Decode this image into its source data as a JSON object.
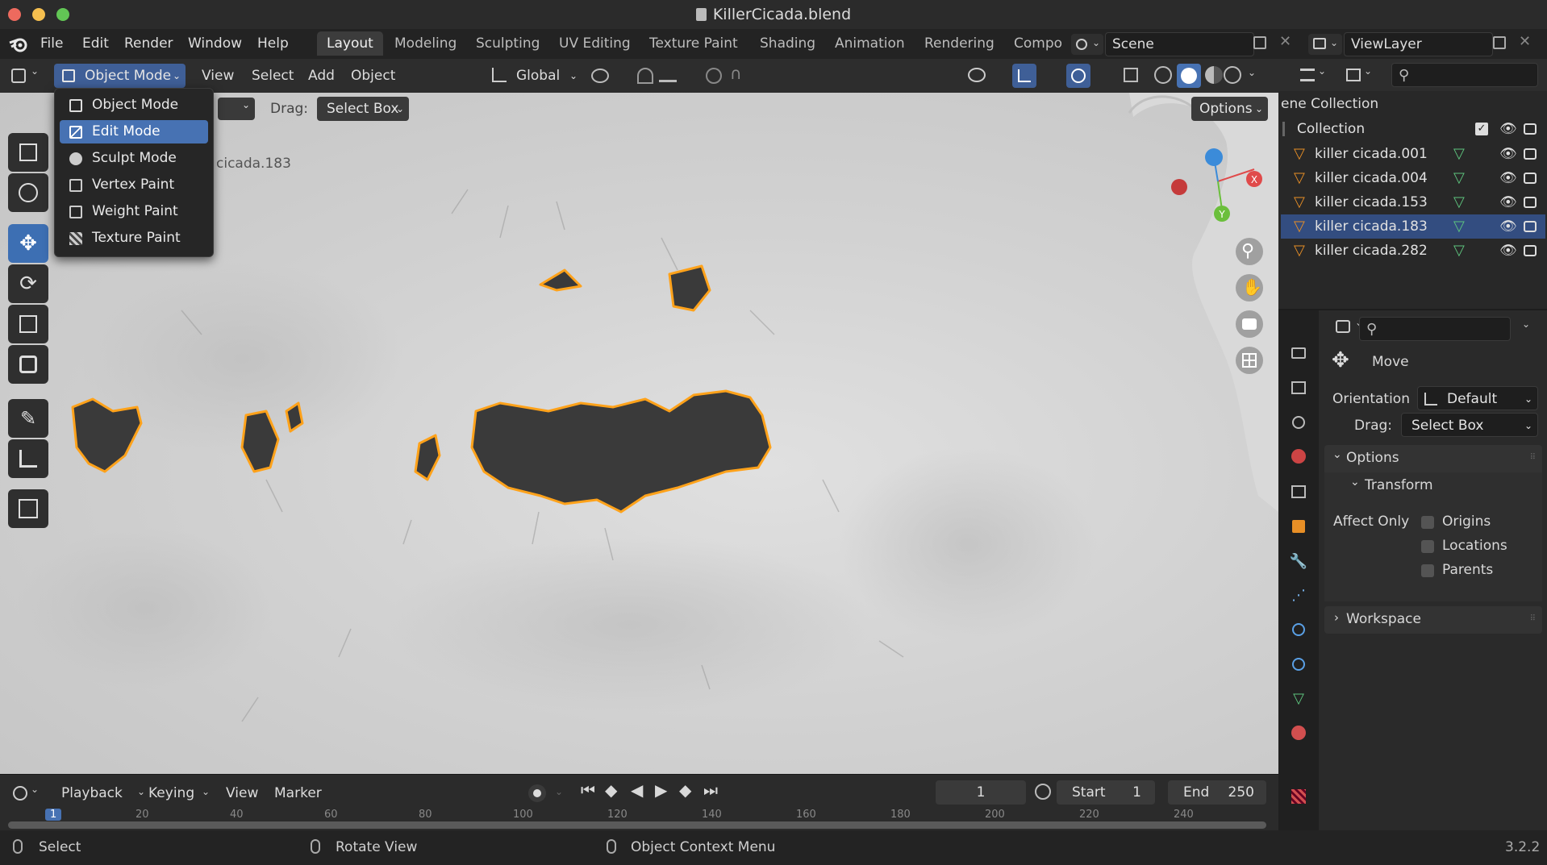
{
  "window": {
    "title": "KillerCicada.blend",
    "version": "3.2.2"
  },
  "menubar": {
    "items": [
      "File",
      "Edit",
      "Render",
      "Window",
      "Help"
    ],
    "workspaces": [
      "Layout",
      "Modeling",
      "Sculpting",
      "UV Editing",
      "Texture Paint",
      "Shading",
      "Animation",
      "Rendering",
      "Compo"
    ],
    "scene": "Scene",
    "view_layer": "ViewLayer"
  },
  "viewport_header": {
    "mode": "Object Mode",
    "menus": [
      "View",
      "Select",
      "Add",
      "Object"
    ],
    "orientation": "Global",
    "drag_label": "Drag:",
    "drag_value": "Select Box",
    "options_label": "Options"
  },
  "mode_menu": {
    "items": [
      {
        "label": "Object Mode",
        "icon": "object-mode-icon"
      },
      {
        "label": "Edit Mode",
        "icon": "edit-mode-icon"
      },
      {
        "label": "Sculpt Mode",
        "icon": "sculpt-mode-icon"
      },
      {
        "label": "Vertex Paint",
        "icon": "vertex-paint-icon"
      },
      {
        "label": "Weight Paint",
        "icon": "weight-paint-icon"
      },
      {
        "label": "Texture Paint",
        "icon": "texture-paint-icon"
      }
    ],
    "highlighted": "Edit Mode"
  },
  "viewport": {
    "object_label": "cicada.183"
  },
  "outliner": {
    "header": "ene Collection",
    "collection": "Collection",
    "objects": [
      {
        "name": "killer cicada.001",
        "selected": false
      },
      {
        "name": "killer cicada.004",
        "selected": false
      },
      {
        "name": "killer cicada.153",
        "selected": false
      },
      {
        "name": "killer cicada.183",
        "selected": true
      },
      {
        "name": "killer cicada.282",
        "selected": false
      }
    ]
  },
  "properties": {
    "tool_name": "Move",
    "orientation_label": "Orientation",
    "orientation_value": "Default",
    "drag_label": "Drag:",
    "drag_value": "Select Box",
    "options_panel": "Options",
    "transform_panel": "Transform",
    "affect_only_label": "Affect Only",
    "affect_only": [
      "Origins",
      "Locations",
      "Parents"
    ],
    "workspace_panel": "Workspace"
  },
  "timeline": {
    "menus": [
      "Playback",
      "Keying",
      "View",
      "Marker"
    ],
    "current_frame": "1",
    "start_label": "Start",
    "start": "1",
    "end_label": "End",
    "end": "250",
    "ruler_marks": [
      "1",
      "20",
      "40",
      "60",
      "80",
      "100",
      "120",
      "140",
      "160",
      "180",
      "200",
      "220",
      "240"
    ]
  },
  "statusbar": {
    "left": "Select",
    "middle": "Rotate View",
    "right": "Object Context Menu"
  },
  "colors": {
    "accent_blue": "#4772b3",
    "selection_orange": "#ffa21a",
    "traffic_close": "#ed6a5e",
    "traffic_min": "#f5bf4f",
    "traffic_max": "#62c655"
  }
}
